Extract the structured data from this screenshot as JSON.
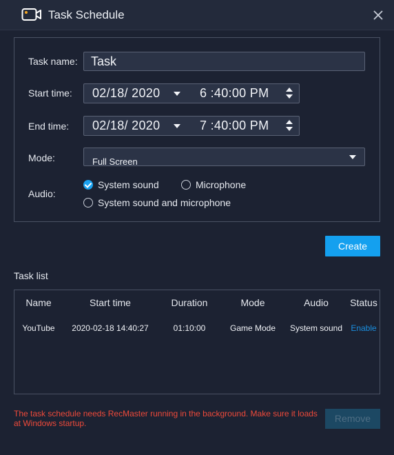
{
  "window": {
    "title": "Task Schedule"
  },
  "form": {
    "task_name_label": "Task name:",
    "task_name_value": "Task",
    "start_label": "Start time:",
    "start_date": "02/18/ 2020",
    "start_time": "6 :40:00  PM",
    "end_label": "End time:",
    "end_date": "02/18/ 2020",
    "end_time": "7 :40:00  PM",
    "mode_label": "Mode:",
    "mode_value": "Full Screen",
    "audio_label": "Audio:",
    "audio_options": [
      {
        "label": "System sound",
        "checked": true
      },
      {
        "label": "Microphone",
        "checked": false
      },
      {
        "label": "System sound and microphone",
        "checked": false
      }
    ]
  },
  "actions": {
    "create_label": "Create",
    "remove_label": "Remove"
  },
  "task_list": {
    "label": "Task list",
    "columns": [
      "Name",
      "Start time",
      "Duration",
      "Mode",
      "Audio",
      "Status"
    ],
    "rows": [
      {
        "name": "YouTube",
        "start": "2020-02-18 14:40:27",
        "duration": "01:10:00",
        "mode": "Game Mode",
        "audio": "System sound",
        "status": "Enable"
      }
    ]
  },
  "warning": "The task schedule needs RecMaster running in the background. Make sure it loads at Windows startup.",
  "colors": {
    "accent": "#14a0ef",
    "warning": "#f04a3a",
    "link": "#1a8fe0"
  }
}
